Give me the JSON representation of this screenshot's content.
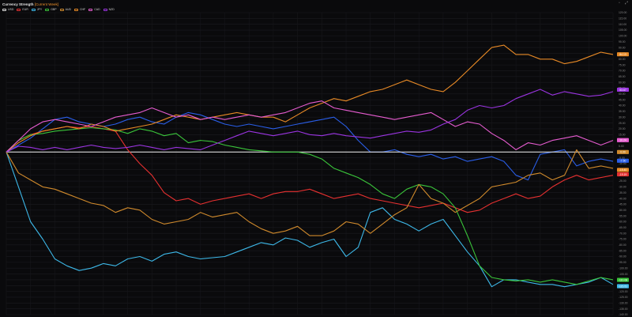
{
  "window": {
    "title": "Currency Strength",
    "subtitle": "[Current Week]",
    "icons": [
      "window-icon",
      "expand-icon"
    ]
  },
  "chart_data": {
    "type": "line",
    "title": "Currency Strength",
    "subtitle": "[Current Week]",
    "ylim": [
      -140,
      120
    ],
    "yticks": [
      120,
      115,
      110,
      105,
      100,
      95,
      90,
      85,
      80,
      75,
      70,
      65,
      60,
      55,
      50,
      45,
      40,
      35,
      30,
      25,
      20,
      15,
      10,
      5,
      0,
      -5,
      -10,
      -15,
      -20,
      -25,
      -30,
      -35,
      -40,
      -45,
      -50,
      -55,
      -60,
      -65,
      -70,
      -75,
      -80,
      -85,
      -90,
      -95,
      -100,
      -105,
      -110,
      -115,
      -120,
      -125,
      -130,
      -135,
      -140
    ],
    "ytick_labels": [
      "120.00",
      "115.00",
      "110.00",
      "105.00",
      "100.00",
      "95.00",
      "90.00",
      "85.00",
      "80.00",
      "75.00",
      "70.00",
      "65.00",
      "60.00",
      "55.00",
      "50.00",
      "45.00",
      "40.00",
      "35.00",
      "30.00",
      "25.00",
      "20.00",
      "15.00",
      "10.00",
      "5.00",
      "0.00",
      "-5.00",
      "-10.00",
      "-15.00",
      "-20.00",
      "-25.00",
      "-30.00",
      "-35.00",
      "-40.00",
      "-45.00",
      "-50.00",
      "-55.00",
      "-60.00",
      "-65.00",
      "-70.00",
      "-75.00",
      "-80.00",
      "-85.00",
      "-90.00",
      "-95.00",
      "-100.00",
      "-105.00",
      "-110.00",
      "-115.00",
      "-120.00",
      "-125.00",
      "-130.00",
      "-135.00",
      "-140.00"
    ],
    "x": [
      0,
      1,
      2,
      3,
      4,
      5,
      6,
      7,
      8,
      9,
      10,
      11,
      12,
      13,
      14,
      15,
      16,
      17,
      18,
      19,
      20,
      21,
      22,
      23,
      24,
      25,
      26,
      27,
      28,
      29,
      30,
      31,
      32,
      33,
      34,
      35,
      36,
      37,
      38,
      39,
      40,
      41,
      42,
      43,
      44,
      45,
      46,
      47,
      48,
      49,
      50
    ],
    "grid": true,
    "legend_position": "top-left",
    "series": [
      {
        "name": "USD",
        "color": "#d9d9d9",
        "last_label": "0.00",
        "values": [
          0,
          0,
          0,
          0,
          0,
          0,
          0,
          0,
          0,
          0,
          0,
          0,
          0,
          0,
          0,
          0,
          0,
          0,
          0,
          0,
          0,
          0,
          0,
          0,
          0,
          0,
          0,
          0,
          0,
          0,
          0,
          0,
          0,
          0,
          0,
          0,
          0,
          0,
          0,
          0,
          0,
          0,
          0,
          0,
          0,
          0,
          0,
          0,
          0,
          0,
          0
        ]
      },
      {
        "name": "EUR",
        "color": "#e53030",
        "last_label": "-19.19",
        "values": [
          0,
          10,
          15,
          18,
          20,
          22,
          21,
          22,
          20,
          18,
          2,
          -10,
          -20,
          -35,
          -42,
          -40,
          -45,
          -42,
          -40,
          -38,
          -36,
          -40,
          -36,
          -34,
          -34,
          -32,
          -36,
          -40,
          -38,
          -36,
          -40,
          -42,
          -44,
          -46,
          -48,
          -46,
          -44,
          -48,
          -52,
          -50,
          -44,
          -40,
          -36,
          -40,
          -38,
          -30,
          -24,
          -20,
          -24,
          -22,
          -20
        ]
      },
      {
        "name": "JPY",
        "color": "#3db8e8",
        "last_label": "-115.51",
        "values": [
          0,
          -30,
          -60,
          -75,
          -92,
          -98,
          -102,
          -100,
          -96,
          -98,
          -92,
          -90,
          -94,
          -88,
          -86,
          -90,
          -92,
          -91,
          -90,
          -86,
          -82,
          -78,
          -80,
          -74,
          -76,
          -82,
          -78,
          -75,
          -90,
          -82,
          -52,
          -48,
          -58,
          -62,
          -68,
          -62,
          -58,
          -72,
          -86,
          -98,
          -116,
          -110,
          -110,
          -112,
          -114,
          -114,
          -116,
          -114,
          -112,
          -108,
          -114
        ]
      },
      {
        "name": "GBP",
        "color": "#3ac43a",
        "last_label": "-110.08",
        "values": [
          0,
          10,
          15,
          16,
          18,
          19,
          20,
          21,
          20,
          19,
          16,
          20,
          18,
          14,
          16,
          8,
          10,
          9,
          6,
          4,
          2,
          1,
          0,
          0,
          0,
          -2,
          -6,
          -14,
          -18,
          -22,
          -28,
          -36,
          -40,
          -32,
          -28,
          -30,
          -36,
          -48,
          -72,
          -98,
          -108,
          -110,
          -111,
          -110,
          -112,
          -110,
          -112,
          -114,
          -111,
          -108,
          -110
        ]
      },
      {
        "name": "AUD",
        "color": "#d08a2c",
        "last_label": "-14.66",
        "values": [
          0,
          -18,
          -24,
          -30,
          -32,
          -36,
          -40,
          -44,
          -46,
          -52,
          -48,
          -50,
          -58,
          -62,
          -60,
          -58,
          -52,
          -56,
          -54,
          -52,
          -60,
          -66,
          -70,
          -68,
          -64,
          -72,
          -72,
          -68,
          -60,
          -62,
          -70,
          -62,
          -54,
          -48,
          -28,
          -40,
          -44,
          -52,
          -46,
          -40,
          -30,
          -28,
          -26,
          -20,
          -18,
          -24,
          -20,
          2,
          -14,
          -12,
          -14
        ]
      },
      {
        "name": "CHF",
        "color": "#e88a26",
        "last_label": "84.13",
        "values": [
          0,
          8,
          14,
          18,
          20,
          22,
          20,
          24,
          22,
          18,
          20,
          22,
          24,
          28,
          32,
          30,
          28,
          30,
          32,
          34,
          32,
          30,
          30,
          26,
          32,
          38,
          42,
          46,
          44,
          48,
          52,
          54,
          58,
          62,
          58,
          54,
          52,
          60,
          70,
          80,
          90,
          92,
          84,
          84,
          80,
          80,
          76,
          78,
          82,
          86,
          84
        ]
      },
      {
        "name": "CAD",
        "color": "#e65cd0",
        "last_label": "10.24",
        "values": [
          0,
          10,
          20,
          26,
          28,
          26,
          24,
          22,
          26,
          30,
          32,
          34,
          38,
          34,
          30,
          32,
          28,
          30,
          28,
          30,
          32,
          30,
          32,
          34,
          38,
          42,
          44,
          38,
          36,
          34,
          32,
          30,
          28,
          30,
          32,
          34,
          28,
          22,
          26,
          24,
          16,
          10,
          2,
          8,
          6,
          10,
          12,
          14,
          10,
          6,
          10
        ]
      },
      {
        "name": "NZD",
        "color": "#9a34e0",
        "last_label": "53.67",
        "values": [
          0,
          5,
          4,
          2,
          4,
          2,
          4,
          6,
          4,
          3,
          4,
          6,
          4,
          2,
          4,
          3,
          2,
          6,
          10,
          14,
          18,
          16,
          14,
          16,
          18,
          15,
          14,
          16,
          14,
          13,
          12,
          14,
          16,
          18,
          17,
          19,
          24,
          28,
          36,
          40,
          38,
          40,
          46,
          50,
          54,
          49,
          52,
          50,
          48,
          49,
          52
        ]
      }
    ],
    "bar_end_labels": [
      "84.13",
      "53.67",
      "10.24",
      "0.00",
      "-7.50",
      "-15.40",
      "-19.19",
      "-110.08",
      "-115.51"
    ],
    "bar_end_colors": [
      "#e88a26",
      "#9a34e0",
      "#e65cd0",
      "#d08a2c",
      "#2a5ee8",
      "#e88a26",
      "#e53030",
      "#3ac43a",
      "#3db8e8"
    ],
    "bar_end_values": [
      84.13,
      53.67,
      10.24,
      0.0,
      -7.5,
      -15.4,
      -19.19,
      -110.08,
      -115.51
    ],
    "extra_series": {
      "name": "",
      "color": "#2a5ee8",
      "values": [
        0,
        6,
        12,
        20,
        28,
        30,
        26,
        24,
        22,
        24,
        28,
        30,
        26,
        24,
        30,
        34,
        32,
        28,
        24,
        22,
        24,
        22,
        20,
        22,
        24,
        26,
        28,
        30,
        22,
        10,
        0,
        0,
        2,
        -2,
        -4,
        -2,
        -6,
        -4,
        -8,
        -6,
        -4,
        -8,
        -20,
        -24,
        -2,
        0,
        2,
        -12,
        -8,
        -6,
        -8
      ]
    }
  }
}
